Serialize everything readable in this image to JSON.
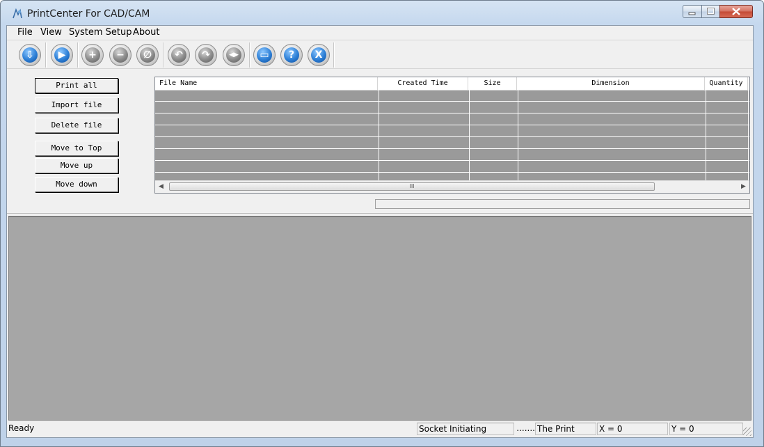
{
  "window": {
    "title": "PrintCenter For CAD/CAM",
    "controls": [
      "minimize",
      "maximize",
      "close"
    ]
  },
  "menu": [
    "File",
    "View",
    "System Setup",
    "About"
  ],
  "toolbar": {
    "buttons": [
      {
        "name": "import-download-icon",
        "glyph": "⇩"
      },
      {
        "name": "play-icon",
        "glyph": "▶"
      },
      {
        "name": "zoom-in-icon",
        "glyph": "+"
      },
      {
        "name": "zoom-out-icon",
        "glyph": "−"
      },
      {
        "name": "zoom-fit-icon",
        "glyph": "∅"
      },
      {
        "name": "rotate-left-icon",
        "glyph": "↶"
      },
      {
        "name": "rotate-right-icon",
        "glyph": "↷"
      },
      {
        "name": "mirror-icon",
        "glyph": "◀▶"
      },
      {
        "name": "window-layout-icon",
        "glyph": "▭"
      },
      {
        "name": "help-icon",
        "glyph": "?"
      },
      {
        "name": "exit-icon",
        "glyph": "X"
      }
    ]
  },
  "side_buttons": {
    "print_all": "Print all",
    "import_file": "Import file",
    "delete_file": "Delete file",
    "move_to_top": "Move to Top",
    "move_up": "Move up",
    "move_down": "Move down"
  },
  "table": {
    "columns": [
      "File Name",
      "Created Time",
      "Size",
      "Dimension",
      "Quantity"
    ],
    "rows": []
  },
  "scrollbar": {
    "thumb_glyph": "III"
  },
  "statusbar": {
    "ready": "Ready",
    "socket": "Socket Initiating",
    "dots": ".......",
    "print": "The Print",
    "x": "X = 0",
    "y": "Y = 0"
  },
  "colors": {
    "table_bg": "#9a9a9a",
    "preview_bg": "#a6a6a6",
    "toolbar_blue": "#2d7fd6"
  }
}
